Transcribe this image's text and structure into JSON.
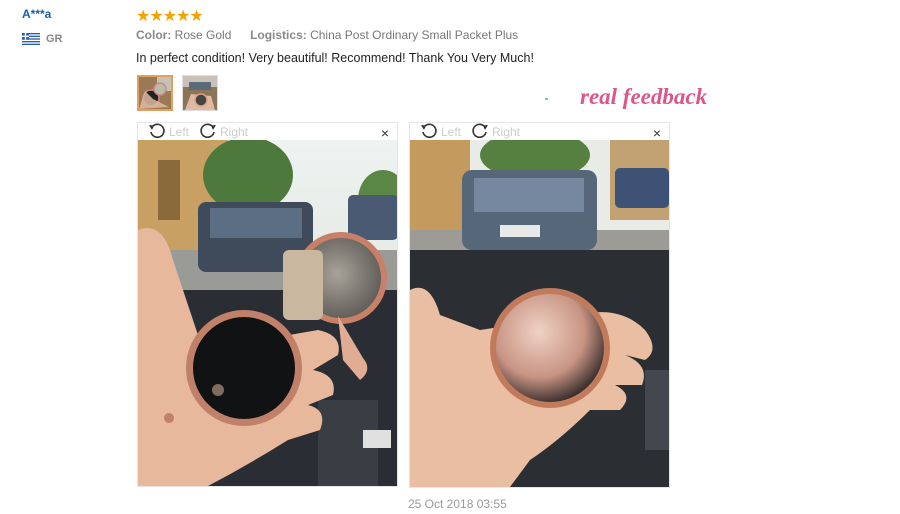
{
  "user": {
    "name": "A***a",
    "country": "GR"
  },
  "review": {
    "rating": 5,
    "stars_text": "★★★★★",
    "color_label": "Color:",
    "color_value": "Rose Gold",
    "logistics_label": "Logistics:",
    "logistics_value": "China Post Ordinary Small Packet Plus",
    "text": "In perfect condition! Very beautiful! Recommend! Thank You Very Much!",
    "timestamp": "25 Oct 2018 03:55"
  },
  "watermark_text": "real  feedback",
  "viewer": {
    "left_label": "Left",
    "right_label": "Right",
    "close_glyph": "×"
  },
  "colors": {
    "accent_star": "#f5a300",
    "user_link": "#1a5ea8",
    "watermark": "#d9578a",
    "selected_thumb_border": "#e2a05a"
  },
  "icons": [
    "flag-greece-icon",
    "rotate-left-icon",
    "rotate-right-icon",
    "close-icon"
  ]
}
